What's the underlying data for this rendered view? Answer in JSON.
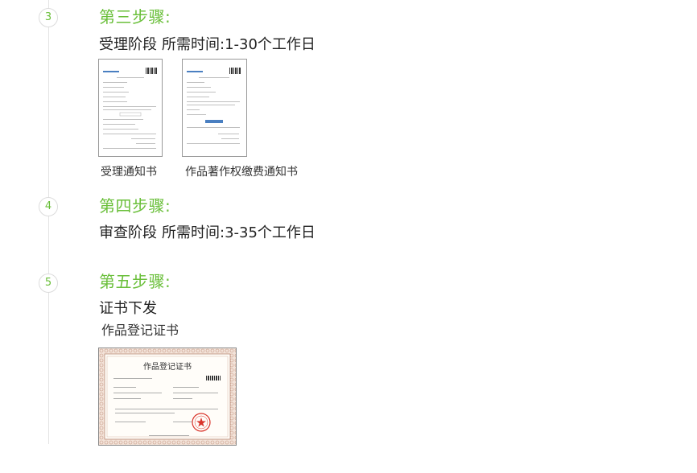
{
  "steps": [
    {
      "number": "3",
      "title": "第三步骤:",
      "stage": "受理阶段",
      "time": "所需时间:1-30个工作日",
      "documents": [
        {
          "caption": "受理通知书",
          "icon": "document-thumbnail-icon"
        },
        {
          "caption": "作品著作权缴费通知书",
          "icon": "document-thumbnail-icon"
        }
      ]
    },
    {
      "number": "4",
      "title": "第四步骤:",
      "stage": "审查阶段",
      "time": "所需时间:3-35个工作日"
    },
    {
      "number": "5",
      "title": "第五步骤:",
      "stage": "证书下发",
      "subtitle": "作品登记证书",
      "certificate": {
        "heading": "作品登记证书",
        "icon": "certificate-image-icon",
        "seal_color": "#d9342b"
      }
    }
  ],
  "colors": {
    "accent": "#6abf3a",
    "timeline": "#e3e3e3"
  }
}
